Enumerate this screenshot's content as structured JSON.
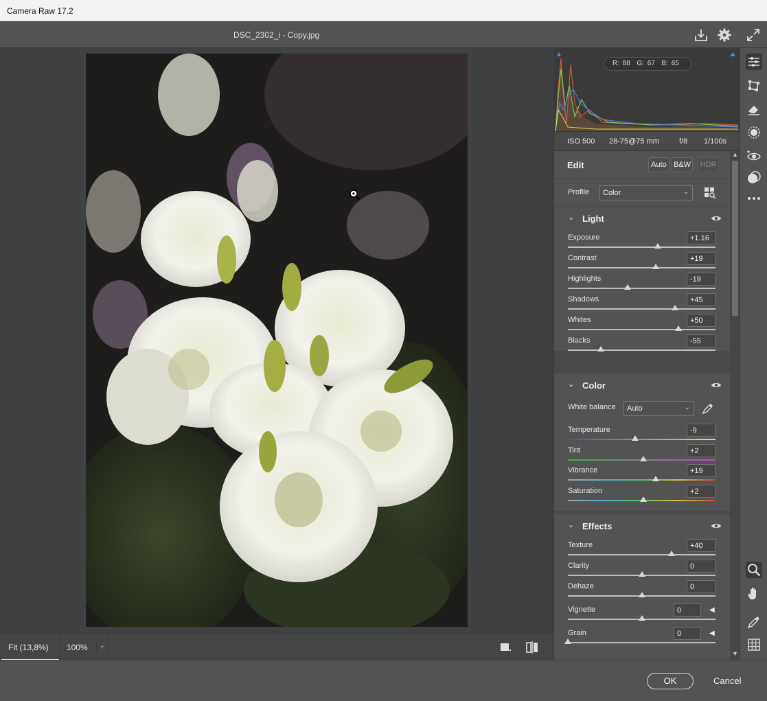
{
  "window": {
    "title": "Camera Raw 17.2"
  },
  "topbar": {
    "filename": "DSC_2302_i - Copy.jpg"
  },
  "histogram": {
    "r_label": "R: 88",
    "g_label": "G: 67",
    "b_label": "B: 65"
  },
  "exif": {
    "iso": "ISO 500",
    "lens": "28-75@75 mm",
    "aperture": "f/8",
    "shutter": "1/100s"
  },
  "edit": {
    "title": "Edit",
    "auto": "Auto",
    "bw": "B&W",
    "hdr": "HDR"
  },
  "profile": {
    "label": "Profile",
    "value": "Color"
  },
  "light": {
    "title": "Light",
    "sliders": [
      {
        "label": "Exposure",
        "value": "+1.16",
        "pos": 0.61
      },
      {
        "label": "Contrast",
        "value": "+19",
        "pos": 0.595
      },
      {
        "label": "Highlights",
        "value": "-19",
        "pos": 0.405
      },
      {
        "label": "Shadows",
        "value": "+45",
        "pos": 0.725
      },
      {
        "label": "Whites",
        "value": "+50",
        "pos": 0.75
      },
      {
        "label": "Blacks",
        "value": "-55",
        "pos": 0.225
      }
    ]
  },
  "color": {
    "title": "Color",
    "wb_label": "White balance",
    "wb_value": "Auto",
    "sliders": [
      {
        "label": "Temperature",
        "value": "-9",
        "pos": 0.455
      },
      {
        "label": "Tint",
        "value": "+2",
        "pos": 0.51
      },
      {
        "label": "Vibrance",
        "value": "+19",
        "pos": 0.595
      },
      {
        "label": "Saturation",
        "value": "+2",
        "pos": 0.51
      }
    ]
  },
  "effects": {
    "title": "Effects",
    "sliders": [
      {
        "label": "Texture",
        "value": "+40",
        "pos": 0.7
      },
      {
        "label": "Clarity",
        "value": "0",
        "pos": 0.5
      },
      {
        "label": "Dehaze",
        "value": "0",
        "pos": 0.5
      },
      {
        "label": "Vignette",
        "value": "0",
        "pos": 0.5
      },
      {
        "label": "Grain",
        "value": "0",
        "pos": 0.0
      }
    ]
  },
  "bottom": {
    "fit": "Fit (13,8%)",
    "zoom": "100%"
  },
  "footer": {
    "ok": "OK",
    "cancel": "Cancel"
  }
}
